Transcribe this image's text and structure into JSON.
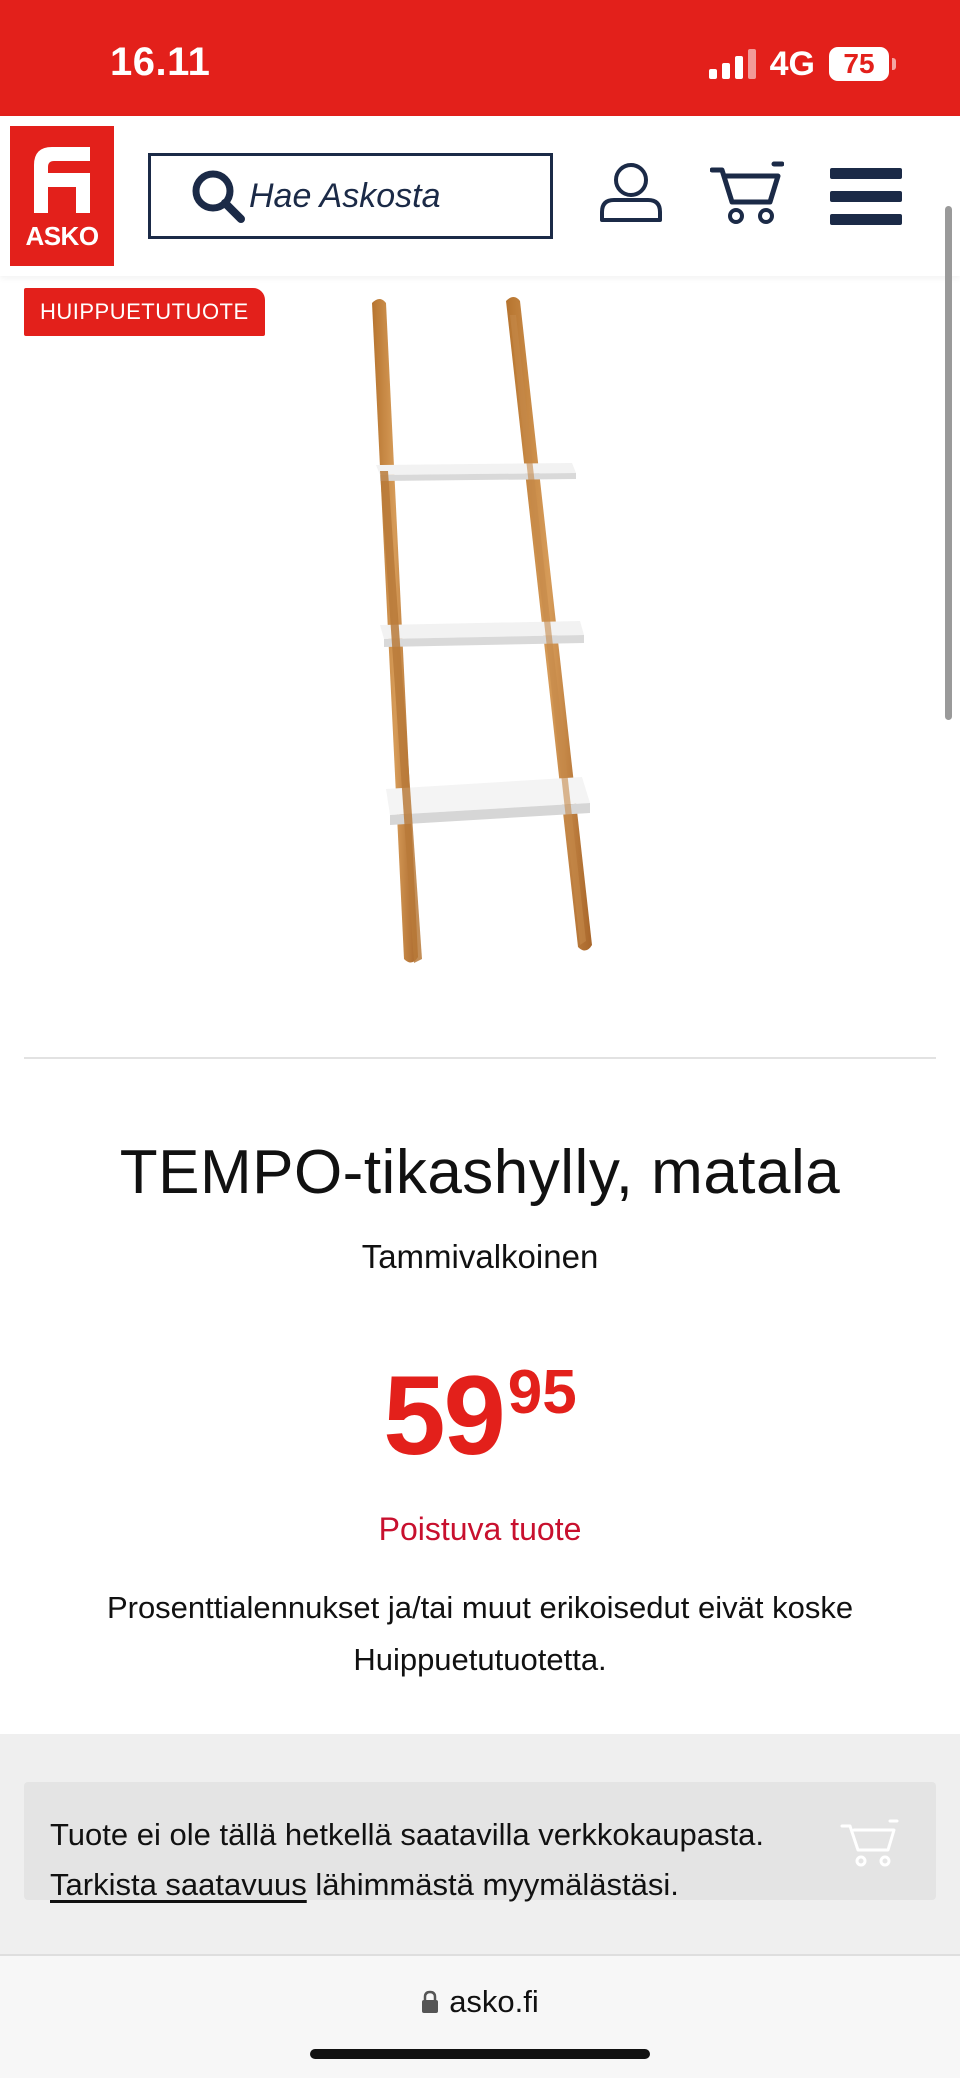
{
  "status_bar": {
    "time": "16.11",
    "network": "4G",
    "battery": "75"
  },
  "header": {
    "logo_text": "ASKO",
    "search_placeholder": "Hae Askosta",
    "icons": [
      "account-icon",
      "cart-icon",
      "menu-icon"
    ]
  },
  "product": {
    "badge": "HUIPPUETUTUOTE",
    "image_name": "product-image",
    "title": "TEMPO-tikashylly, matala",
    "variant": "Tammivalkoinen",
    "price_integer": "59",
    "price_decimals": "95",
    "status": "Poistuva tuote",
    "disclaimer": "Prosenttialennukset ja/tai muut erikoisedut eivät koske Huippuetutuotetta."
  },
  "availability": {
    "line1": "Tuote ei ole tällä hetkellä saatavilla verkkokaupasta.",
    "link_text": "Tarkista saatavuus",
    "line2_rest": " lähimmästä myymälästäsi."
  },
  "browser": {
    "url": "asko.fi"
  },
  "colors": {
    "brand_red": "#e3201b",
    "navy": "#1b2a47",
    "status_red": "#c8102e"
  }
}
